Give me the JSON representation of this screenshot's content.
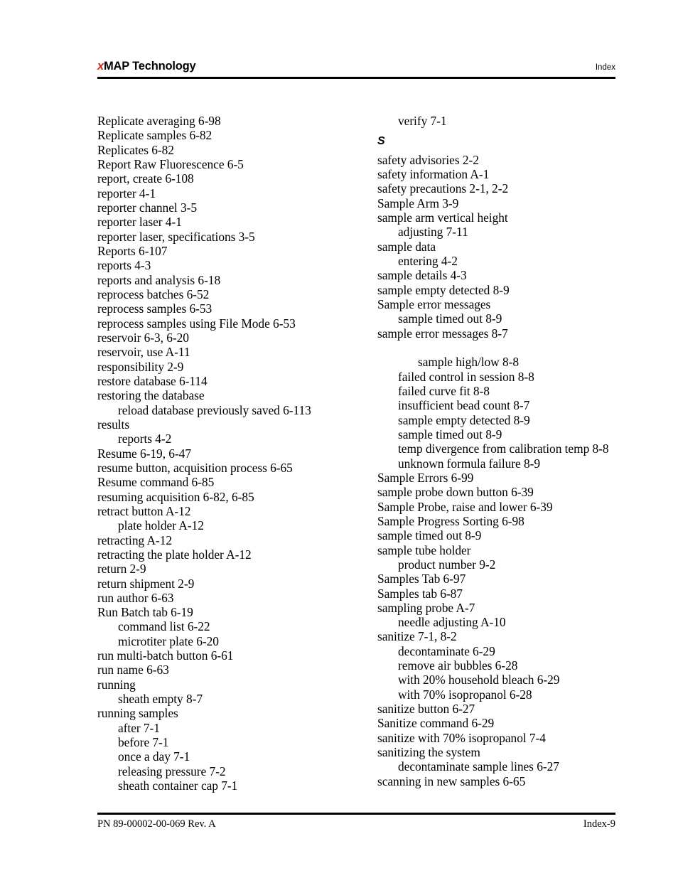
{
  "header": {
    "brand_x": "x",
    "brand_rest": "MAP Technology",
    "right_label": "Index"
  },
  "footer": {
    "part_number": "PN 89-00002-00-069 Rev. A",
    "page_label": "Index-9"
  },
  "columns": {
    "left": [
      {
        "type": "entry",
        "level": 0,
        "text": "Replicate averaging 6-98"
      },
      {
        "type": "entry",
        "level": 0,
        "text": "Replicate samples 6-82"
      },
      {
        "type": "entry",
        "level": 0,
        "text": "Replicates 6-82"
      },
      {
        "type": "entry",
        "level": 0,
        "text": "Report Raw Fluorescence 6-5"
      },
      {
        "type": "entry",
        "level": 0,
        "text": "report, create 6-108"
      },
      {
        "type": "entry",
        "level": 0,
        "text": "reporter 4-1"
      },
      {
        "type": "entry",
        "level": 0,
        "text": "reporter channel 3-5"
      },
      {
        "type": "entry",
        "level": 0,
        "text": "reporter laser 4-1"
      },
      {
        "type": "entry",
        "level": 0,
        "text": "reporter laser, specifications 3-5"
      },
      {
        "type": "entry",
        "level": 0,
        "text": "Reports 6-107"
      },
      {
        "type": "entry",
        "level": 0,
        "text": "reports 4-3"
      },
      {
        "type": "entry",
        "level": 0,
        "text": "reports and analysis 6-18"
      },
      {
        "type": "entry",
        "level": 0,
        "text": "reprocess batches 6-52"
      },
      {
        "type": "entry",
        "level": 0,
        "text": "reprocess samples 6-53"
      },
      {
        "type": "entry",
        "level": 0,
        "text": "reprocess samples using File Mode 6-53"
      },
      {
        "type": "entry",
        "level": 0,
        "text": "reservoir 6-3, 6-20"
      },
      {
        "type": "entry",
        "level": 0,
        "text": "reservoir, use A-11"
      },
      {
        "type": "entry",
        "level": 0,
        "text": "responsibility 2-9"
      },
      {
        "type": "entry",
        "level": 0,
        "text": "restore database 6-114"
      },
      {
        "type": "entry",
        "level": 0,
        "text": "restoring the database"
      },
      {
        "type": "entry",
        "level": 1,
        "text": "reload database previously saved 6-113"
      },
      {
        "type": "entry",
        "level": 0,
        "text": "results"
      },
      {
        "type": "entry",
        "level": 1,
        "text": "reports 4-2"
      },
      {
        "type": "entry",
        "level": 0,
        "text": "Resume 6-19, 6-47"
      },
      {
        "type": "entry",
        "level": 0,
        "text": "resume button, acquisition process 6-65"
      },
      {
        "type": "entry",
        "level": 0,
        "text": "Resume command 6-85"
      },
      {
        "type": "entry",
        "level": 0,
        "text": "resuming acquisition 6-82, 6-85"
      },
      {
        "type": "entry",
        "level": 0,
        "text": "retract button A-12"
      },
      {
        "type": "entry",
        "level": 1,
        "text": "plate holder A-12"
      },
      {
        "type": "entry",
        "level": 0,
        "text": "retracting A-12"
      },
      {
        "type": "entry",
        "level": 0,
        "text": "retracting the plate holder A-12"
      },
      {
        "type": "entry",
        "level": 0,
        "text": "return 2-9"
      },
      {
        "type": "entry",
        "level": 0,
        "text": "return shipment 2-9"
      },
      {
        "type": "entry",
        "level": 0,
        "text": "run author 6-63"
      },
      {
        "type": "entry",
        "level": 0,
        "text": "Run Batch tab 6-19"
      },
      {
        "type": "entry",
        "level": 1,
        "text": "command list 6-22"
      },
      {
        "type": "entry",
        "level": 1,
        "text": "microtiter plate 6-20"
      },
      {
        "type": "entry",
        "level": 0,
        "text": "run multi-batch button 6-61"
      },
      {
        "type": "entry",
        "level": 0,
        "text": "run name 6-63"
      },
      {
        "type": "entry",
        "level": 0,
        "text": "running"
      },
      {
        "type": "entry",
        "level": 1,
        "text": "sheath empty 8-7"
      },
      {
        "type": "entry",
        "level": 0,
        "text": "running samples"
      },
      {
        "type": "entry",
        "level": 1,
        "text": "after 7-1"
      },
      {
        "type": "entry",
        "level": 1,
        "text": "before 7-1"
      },
      {
        "type": "entry",
        "level": 1,
        "text": "once a day 7-1"
      },
      {
        "type": "entry",
        "level": 1,
        "text": "releasing pressure 7-2"
      },
      {
        "type": "entry",
        "level": 1,
        "text": "sheath container cap 7-1"
      }
    ],
    "right": [
      {
        "type": "entry",
        "level": 1,
        "text": "verify 7-1"
      },
      {
        "type": "heading",
        "text": "S"
      },
      {
        "type": "entry",
        "level": 0,
        "text": "safety advisories 2-2"
      },
      {
        "type": "entry",
        "level": 0,
        "text": "safety information A-1"
      },
      {
        "type": "entry",
        "level": 0,
        "text": "safety precautions 2-1, 2-2"
      },
      {
        "type": "entry",
        "level": 0,
        "text": "Sample Arm 3-9"
      },
      {
        "type": "entry",
        "level": 0,
        "text": "sample arm vertical height"
      },
      {
        "type": "entry",
        "level": 1,
        "text": "adjusting 7-11"
      },
      {
        "type": "entry",
        "level": 0,
        "text": "sample data"
      },
      {
        "type": "entry",
        "level": 1,
        "text": "entering 4-2"
      },
      {
        "type": "entry",
        "level": 0,
        "text": "sample details 4-3"
      },
      {
        "type": "entry",
        "level": 0,
        "text": "sample empty detected 8-9"
      },
      {
        "type": "entry",
        "level": 0,
        "text": "Sample error messages"
      },
      {
        "type": "entry",
        "level": 1,
        "text": "sample timed out 8-9"
      },
      {
        "type": "entry",
        "level": 0,
        "text": "sample error messages 8-7"
      },
      {
        "type": "spacer"
      },
      {
        "type": "entry",
        "level": 2,
        "text": "sample high/low 8-8"
      },
      {
        "type": "entry",
        "level": 1,
        "text": "failed control in session 8-8"
      },
      {
        "type": "entry",
        "level": 1,
        "text": "failed curve fit 8-8"
      },
      {
        "type": "entry",
        "level": 1,
        "text": "insufficient bead count 8-7"
      },
      {
        "type": "entry",
        "level": 1,
        "text": "sample empty detected 8-9"
      },
      {
        "type": "entry",
        "level": 1,
        "text": "sample timed out 8-9"
      },
      {
        "type": "entry",
        "level": 1,
        "text": "temp divergence from calibration temp 8-8"
      },
      {
        "type": "entry",
        "level": 1,
        "text": "unknown formula failure 8-9"
      },
      {
        "type": "entry",
        "level": 0,
        "text": "Sample Errors 6-99"
      },
      {
        "type": "entry",
        "level": 0,
        "text": "sample probe down button 6-39"
      },
      {
        "type": "entry",
        "level": 0,
        "text": "Sample Probe, raise and lower 6-39"
      },
      {
        "type": "entry",
        "level": 0,
        "text": "Sample Progress Sorting 6-98"
      },
      {
        "type": "entry",
        "level": 0,
        "text": "sample timed out 8-9"
      },
      {
        "type": "entry",
        "level": 0,
        "text": "sample tube holder"
      },
      {
        "type": "entry",
        "level": 1,
        "text": "product number 9-2"
      },
      {
        "type": "entry",
        "level": 0,
        "text": "Samples Tab 6-97"
      },
      {
        "type": "entry",
        "level": 0,
        "text": "Samples tab 6-87"
      },
      {
        "type": "entry",
        "level": 0,
        "text": "sampling probe A-7"
      },
      {
        "type": "entry",
        "level": 1,
        "text": "needle adjusting A-10"
      },
      {
        "type": "entry",
        "level": 0,
        "text": "sanitize 7-1, 8-2"
      },
      {
        "type": "entry",
        "level": 1,
        "text": "decontaminate 6-29"
      },
      {
        "type": "entry",
        "level": 1,
        "text": "remove air bubbles 6-28"
      },
      {
        "type": "entry",
        "level": 1,
        "text": "with 20% household bleach 6-29"
      },
      {
        "type": "entry",
        "level": 1,
        "text": "with 70% isopropanol 6-28"
      },
      {
        "type": "entry",
        "level": 0,
        "text": "sanitize button 6-27"
      },
      {
        "type": "entry",
        "level": 0,
        "text": "Sanitize command 6-29"
      },
      {
        "type": "entry",
        "level": 0,
        "text": "sanitize with 70% isopropanol 7-4"
      },
      {
        "type": "entry",
        "level": 0,
        "text": "sanitizing the system"
      },
      {
        "type": "entry",
        "level": 1,
        "text": "decontaminate sample lines 6-27"
      },
      {
        "type": "entry",
        "level": 0,
        "text": "scanning in new samples 6-65"
      }
    ]
  }
}
